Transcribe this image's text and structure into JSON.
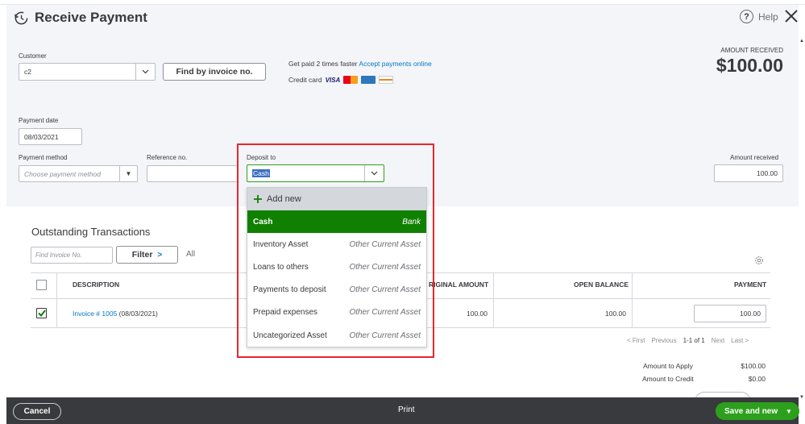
{
  "header": {
    "title": "Receive Payment",
    "help_label": "Help"
  },
  "customer": {
    "label": "Customer",
    "value": "c2",
    "find_button": "Find by invoice no."
  },
  "promo": {
    "getpaid_text": "Get paid 2 times faster",
    "accept_link": "Accept payments online",
    "credit_card_label": "Credit card",
    "visa_label": "VISA"
  },
  "amount_received_header": {
    "label": "AMOUNT RECEIVED",
    "value": "$100.00"
  },
  "payment_date": {
    "label": "Payment date",
    "value": "08/03/2021"
  },
  "payment_method": {
    "label": "Payment method",
    "placeholder": "Choose payment method"
  },
  "reference": {
    "label": "Reference no.",
    "value": ""
  },
  "deposit_to": {
    "label": "Deposit to",
    "value": "Cash",
    "add_new": "Add new",
    "options": [
      {
        "name": "Cash",
        "type": "Bank",
        "selected": true
      },
      {
        "name": "Inventory Asset",
        "type": "Other Current Asset",
        "selected": false
      },
      {
        "name": "Loans to others",
        "type": "Other Current Asset",
        "selected": false
      },
      {
        "name": "Payments to deposit",
        "type": "Other Current Asset",
        "selected": false
      },
      {
        "name": "Prepaid expenses",
        "type": "Other Current Asset",
        "selected": false
      },
      {
        "name": "Uncategorized Asset",
        "type": "Other Current Asset",
        "selected": false
      }
    ]
  },
  "amount_received": {
    "label": "Amount received",
    "value": "100.00"
  },
  "outstanding": {
    "title": "Outstanding Transactions",
    "find_placeholder": "Find Invoice No.",
    "filter_label": "Filter",
    "all_label": "All",
    "columns": {
      "description": "DESCRIPTION",
      "original_amount": "RIGINAL AMOUNT",
      "open_balance": "OPEN BALANCE",
      "payment": "PAYMENT"
    },
    "rows": [
      {
        "checked": true,
        "invoice_link": "Invoice # 1005",
        "invoice_date": "(08/03/2021)",
        "original_amount": "100.00",
        "open_balance": "100.00",
        "payment": "100.00"
      }
    ],
    "pager": {
      "first": "< First",
      "previous": "Previous",
      "range": "1-1 of 1",
      "next": "Next",
      "last": "Last >"
    }
  },
  "totals": {
    "apply_label": "Amount to Apply",
    "apply_value": "$100.00",
    "credit_label": "Amount to Credit",
    "credit_value": "$0.00"
  },
  "footer": {
    "cancel": "Cancel",
    "print": "Print",
    "save": "Save and new"
  },
  "colors": {
    "accent_green": "#2ca01c",
    "selected_green": "#108000",
    "link_blue": "#0077c5",
    "highlight_red": "#e8262d",
    "footer_bg": "#393a3d"
  }
}
